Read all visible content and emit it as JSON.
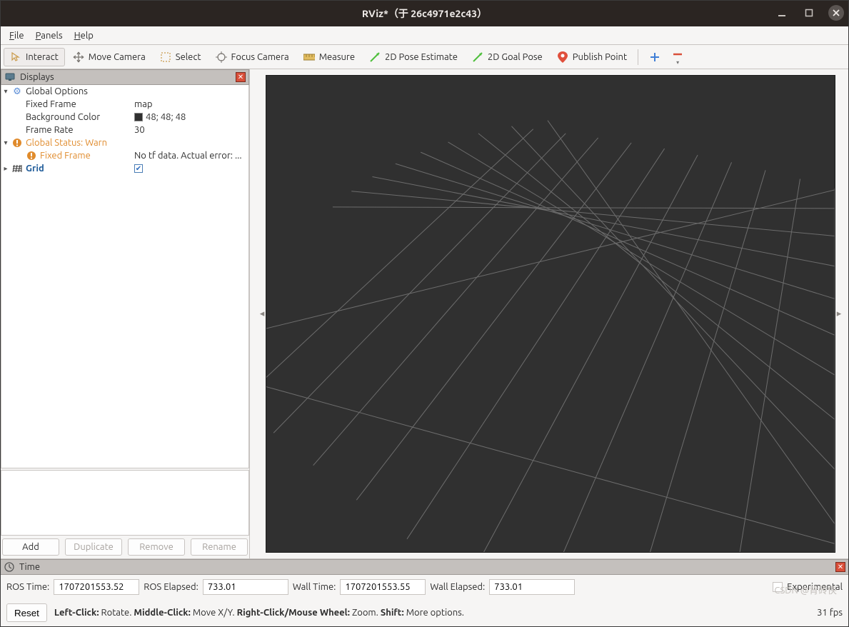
{
  "window": {
    "title": "RViz*（于 26c4971e2c43）"
  },
  "menubar": {
    "file": "File",
    "panels": "Panels",
    "help": "Help"
  },
  "toolbar": {
    "interact": "Interact",
    "move_camera": "Move Camera",
    "select": "Select",
    "focus_camera": "Focus Camera",
    "measure": "Measure",
    "pose_estimate": "2D Pose Estimate",
    "goal_pose": "2D Goal Pose",
    "publish_point": "Publish Point"
  },
  "displays": {
    "title": "Displays",
    "global_options": "Global Options",
    "fixed_frame_label": "Fixed Frame",
    "fixed_frame_value": "map",
    "bg_label": "Background Color",
    "bg_value": "48; 48; 48",
    "bg_hex": "#303030",
    "frame_rate_label": "Frame Rate",
    "frame_rate_value": "30",
    "global_status": "Global Status: Warn",
    "ff_status_label": "Fixed Frame",
    "ff_status_value": "No tf data.  Actual error: ...",
    "grid_label": "Grid",
    "grid_checked": true
  },
  "buttons": {
    "add": "Add",
    "duplicate": "Duplicate",
    "remove": "Remove",
    "rename": "Rename"
  },
  "time": {
    "title": "Time",
    "ros_time_label": "ROS Time:",
    "ros_time_value": "1707201553.52",
    "ros_elapsed_label": "ROS Elapsed:",
    "ros_elapsed_value": "733.01",
    "wall_time_label": "Wall Time:",
    "wall_time_value": "1707201553.55",
    "wall_elapsed_label": "Wall Elapsed:",
    "wall_elapsed_value": "733.01",
    "experimental": "Experimental"
  },
  "status": {
    "reset": "Reset",
    "left": "Left-Click:",
    "left_v": "Rotate.",
    "middle": "Middle-Click:",
    "middle_v": "Move X/Y.",
    "right": "Right-Click/Mouse Wheel:",
    "right_v": "Zoom.",
    "shift": "Shift:",
    "shift_v": "More options.",
    "fps": "31 fps"
  },
  "watermark": "CSDN @背砖侠"
}
